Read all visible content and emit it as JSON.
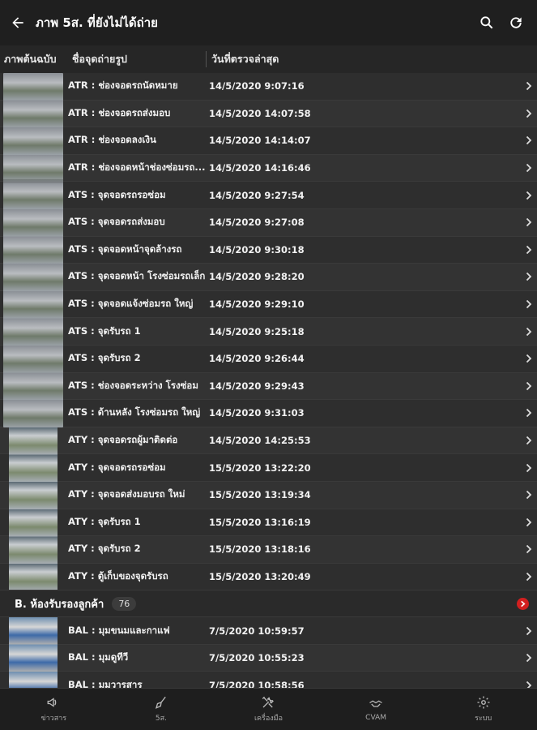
{
  "header": {
    "title": "ภาพ 5ส. ที่ยังไม่ได้ถ่าย",
    "back_icon": "arrow-left-icon",
    "search_icon": "search-icon",
    "refresh_icon": "refresh-icon"
  },
  "columns": {
    "thumbnail": "ภาพต้นฉบับ",
    "name": "ชื่อจุดถ่ายรูป",
    "date": "วันที่ตรวจล่าสุด"
  },
  "rows_a": [
    {
      "name": "ATR : ช่องจอดรถนัดหมาย",
      "date": "14/5/2020 9:07:16"
    },
    {
      "name": "ATR : ช่องจอดรถส่งมอบ",
      "date": "14/5/2020 14:07:58"
    },
    {
      "name": "ATR : ช่องจอดลงเงิน",
      "date": "14/5/2020 14:14:07"
    },
    {
      "name": "ATR : ช่องจอดหน้าช่องซ่อมรถ...",
      "date": "14/5/2020 14:16:46"
    },
    {
      "name": "ATS : จุดจอดรถรอซ่อม",
      "date": "14/5/2020 9:27:54"
    },
    {
      "name": "ATS : จุดจอดรถส่งมอบ",
      "date": "14/5/2020 9:27:08"
    },
    {
      "name": "ATS : จุดจอดหน้าจุดล้างรถ",
      "date": "14/5/2020 9:30:18"
    },
    {
      "name": "ATS : จุดจอดหน้า โรงซ่อมรถเล็ก",
      "date": "14/5/2020 9:28:20"
    },
    {
      "name": "ATS : จุดจอดแจ้งซ่อมรถ ใหญ่",
      "date": "14/5/2020 9:29:10"
    },
    {
      "name": "ATS : จุดรับรถ 1",
      "date": "14/5/2020 9:25:18"
    },
    {
      "name": "ATS : จุดรับรถ 2",
      "date": "14/5/2020 9:26:44"
    },
    {
      "name": "ATS : ช่องจอดระหว่าง โรงซ่อม",
      "date": "14/5/2020 9:29:43"
    },
    {
      "name": "ATS : ด้านหลัง โรงซ่อมรถ ใหญ่",
      "date": "14/5/2020 9:31:03"
    },
    {
      "name": "ATY : จุดจอดรถผู้มาติดต่อ",
      "date": "14/5/2020 14:25:53"
    },
    {
      "name": "ATY : จุดจอดรถรอซ่อม",
      "date": "15/5/2020 13:22:20"
    },
    {
      "name": "ATY : จุดจอดส่งมอบรถ ใหม่",
      "date": "15/5/2020 13:19:34"
    },
    {
      "name": "ATY : จุดรับรถ 1",
      "date": "15/5/2020 13:16:19"
    },
    {
      "name": "ATY : จุดรับรถ 2",
      "date": "15/5/2020 13:18:16"
    },
    {
      "name": "ATY : ตู้เก็บของจุดรับรถ",
      "date": "15/5/2020 13:20:49"
    }
  ],
  "group_b": {
    "title": "B. ห้องรับรองลูกค้า",
    "count": "76"
  },
  "rows_b": [
    {
      "name": "BAL : มุมขนมและกาแฟ",
      "date": "7/5/2020 10:59:57"
    },
    {
      "name": "BAL : มุมดูทีวี",
      "date": "7/5/2020 10:55:23"
    },
    {
      "name": "BAL : มุมวารสาร",
      "date": "7/5/2020 10:58:56"
    }
  ],
  "bottom_nav": [
    {
      "label": "ข่าวสาร",
      "icon": "megaphone-icon"
    },
    {
      "label": "5ส.",
      "icon": "broom-icon"
    },
    {
      "label": "เครื่องมือ",
      "icon": "tools-icon"
    },
    {
      "label": "CVAM",
      "icon": "handshake-icon"
    },
    {
      "label": "ระบบ",
      "icon": "gear-icon"
    }
  ],
  "colors": {
    "background": "#2b2b2b",
    "topbar": "#1f1f1f",
    "alert_dot": "#d21f1f"
  }
}
